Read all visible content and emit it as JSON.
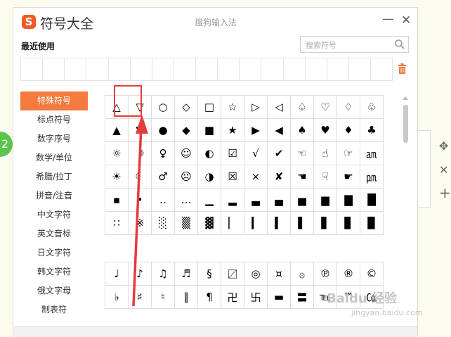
{
  "window": {
    "logo_letter": "S",
    "title": "符号大全",
    "center_title": "搜狗输入法",
    "minimize_label": "—",
    "close_label": "✕"
  },
  "recent": {
    "label": "最近使用"
  },
  "search": {
    "placeholder": "搜索符号"
  },
  "sidebar": {
    "items": [
      {
        "label": "特殊符号",
        "active": true
      },
      {
        "label": "标点符号"
      },
      {
        "label": "数字序号"
      },
      {
        "label": "数学/单位"
      },
      {
        "label": "希腊/拉丁"
      },
      {
        "label": "拼音/注音"
      },
      {
        "label": "中文字符"
      },
      {
        "label": "英文音标"
      },
      {
        "label": "日文字符"
      },
      {
        "label": "韩文字符"
      },
      {
        "label": "俄文字母"
      },
      {
        "label": "制表符"
      }
    ]
  },
  "symbols_grid": [
    [
      "△",
      "▽",
      "○",
      "◇",
      "□",
      "☆",
      "▷",
      "◁",
      "♤",
      "♡",
      "♢",
      "♧"
    ],
    [
      "▲",
      "▼",
      "●",
      "◆",
      "■",
      "★",
      "▶",
      "◀",
      "♠",
      "♥",
      "♦",
      "♣"
    ],
    [
      "☼",
      "☽",
      "♀",
      "☺",
      "◐",
      "☑",
      "√",
      "✔",
      "☜",
      "☝",
      "☞",
      "㏂"
    ],
    [
      "☀",
      "☾",
      "♂",
      "☹",
      "◑",
      "☒",
      "×",
      "✘",
      "☚",
      "☟",
      "☛",
      "㏘"
    ],
    [
      "▪",
      "•",
      "‥",
      "…",
      "▁",
      "▂",
      "▃",
      "▄",
      "▅",
      "▆",
      "▇",
      "█"
    ],
    [
      "∷",
      "※",
      "░",
      "▒",
      "▓",
      "▏",
      "▎",
      "▍",
      "▌",
      "▋",
      "▊",
      "▉"
    ]
  ],
  "symbols_grid2": [
    [
      "♩",
      "♪",
      "♫",
      "♬",
      "§",
      "〼",
      "◎",
      "¤",
      "۞",
      "℗",
      "®",
      "©"
    ],
    [
      "♭",
      "♯",
      "♮",
      "‖",
      "¶",
      "卍",
      "卐",
      "▬",
      "〓",
      "℡",
      "™",
      "㏇"
    ]
  ],
  "badge": {
    "label": "2"
  },
  "tools": {
    "move": "✥",
    "close": "✕",
    "add": "+"
  },
  "watermark": {
    "brand": "Baidu 经验",
    "site": "jingyan.baidu.com"
  },
  "colors": {
    "accent": "#f47a3f",
    "logo": "#f25a24",
    "annotation_red": "#e43b3b",
    "badge_green": "#5ac44b"
  }
}
